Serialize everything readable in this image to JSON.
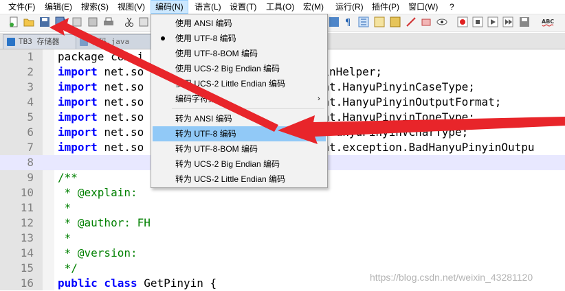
{
  "menubar": {
    "items": [
      {
        "label": "文件(F)"
      },
      {
        "label": "编辑(E)"
      },
      {
        "label": "搜索(S)"
      },
      {
        "label": "视图(V)"
      },
      {
        "label": "编码(N)"
      },
      {
        "label": "语言(L)"
      },
      {
        "label": "设置(T)"
      },
      {
        "label": "工具(O)"
      },
      {
        "label": "宏(M)"
      },
      {
        "label": "运行(R)"
      },
      {
        "label": "插件(P)"
      },
      {
        "label": "窗口(W)"
      },
      {
        "label": "?"
      }
    ]
  },
  "tabs": [
    {
      "label": "TB3 存储器"
    },
    {
      "label": "代码.java"
    }
  ],
  "encoding_menu": {
    "items": [
      {
        "label": "使用 ANSI 编码"
      },
      {
        "label": "使用 UTF-8 编码",
        "checked": true
      },
      {
        "label": "使用 UTF-8-BOM 编码"
      },
      {
        "label": "使用 UCS-2 Big Endian 编码"
      },
      {
        "label": "使用 UCS-2 Little Endian 编码"
      },
      {
        "label": "编码字符集",
        "submenu": true
      },
      {
        "label": "转为 ANSI 编码"
      },
      {
        "label": "转为 UTF-8 编码",
        "highlighted": true
      },
      {
        "label": "转为 UTF-8-BOM 编码"
      },
      {
        "label": "转为 UCS-2 Big Endian 编码"
      },
      {
        "label": "转为 UCS-2 Little Endian 编码"
      }
    ]
  },
  "editor": {
    "lines": [
      {
        "n": "1",
        "kw": "",
        "text": "package com.i"
      },
      {
        "n": "2",
        "kw": "import",
        "text": " net.so                          yinHelper;"
      },
      {
        "n": "3",
        "kw": "import",
        "text": " net.so                          mat.HanyuPinyinCaseType;"
      },
      {
        "n": "4",
        "kw": "import",
        "text": " net.so                          mat.HanyuPinyinOutputFormat;"
      },
      {
        "n": "5",
        "kw": "import",
        "text": " net.so                          mat.HanyuPinyinToneType;"
      },
      {
        "n": "6",
        "kw": "import",
        "text": " net.so                             anyuPinyinVCharType;"
      },
      {
        "n": "7",
        "kw": "import",
        "text": " net.so                          mat.exception.BadHanyuPinyinOutpu"
      },
      {
        "n": "8",
        "kw": "",
        "text": ""
      },
      {
        "n": "9",
        "kw": "",
        "text": "/**",
        "comment": true
      },
      {
        "n": "10",
        "kw": "",
        "text": " * @explain:",
        "comment": true
      },
      {
        "n": "11",
        "kw": "",
        "text": " *",
        "comment": true
      },
      {
        "n": "12",
        "kw": "",
        "text": " * @author: FH",
        "comment": true
      },
      {
        "n": "13",
        "kw": "",
        "text": " *",
        "comment": true
      },
      {
        "n": "14",
        "kw": "",
        "text": " * @version:",
        "comment": true
      },
      {
        "n": "15",
        "kw": "",
        "text": " */",
        "comment": true
      },
      {
        "n": "16",
        "kw": "public class",
        "text": " GetPinyin {"
      }
    ]
  },
  "watermark": "https://blog.csdn.net/weixin_43281120",
  "colors": {
    "keyword": "#0000ff",
    "comment": "#008000",
    "highlight": "#91c9f7",
    "arrow": "#e8252a"
  }
}
